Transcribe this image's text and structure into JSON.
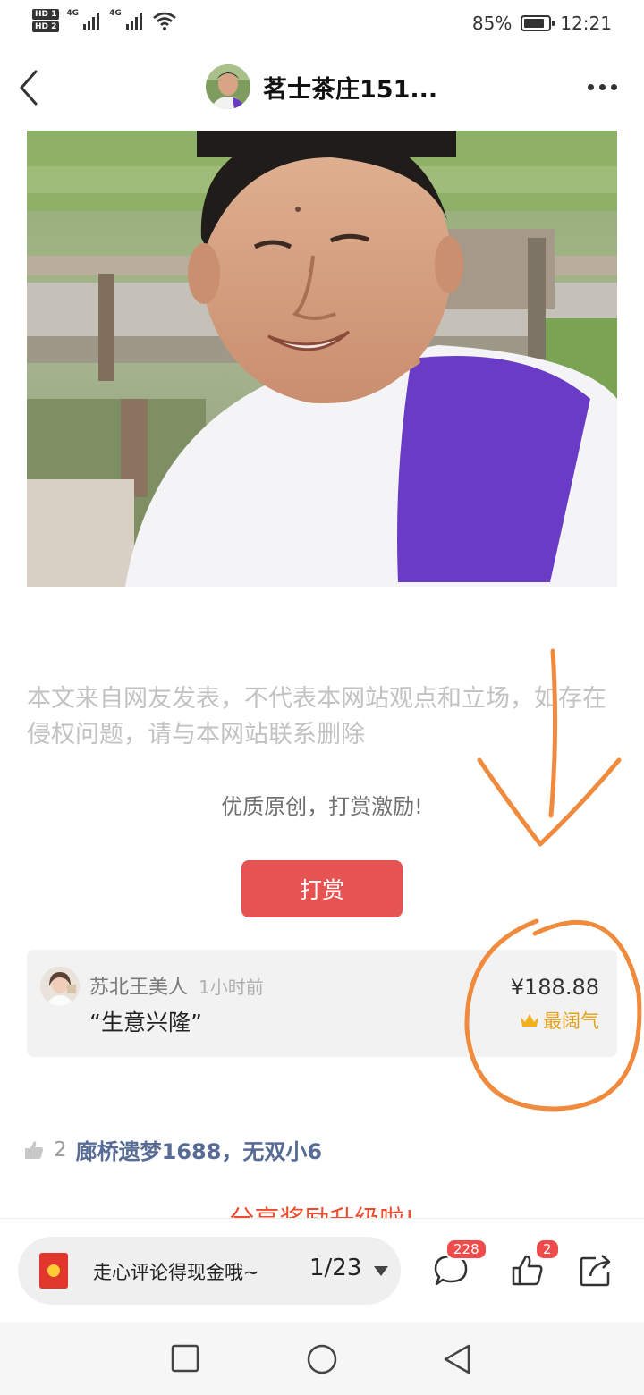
{
  "status_bar": {
    "hd1": "HD 1",
    "hd2": "HD 2",
    "sig1": "4G",
    "sig2": "4G",
    "battery": "85%",
    "battery_level": 0.85,
    "time": "12:21"
  },
  "nav": {
    "title": "茗士茶庄151..."
  },
  "article": {
    "disclaimer": "本文来自网友发表，不代表本网站观点和立场，如存在侵权问题，请与本网站联系删除",
    "reward_caption": "优质原创，打赏激励!",
    "reward_button": "打赏"
  },
  "tip": {
    "name": "苏北王美人",
    "time": "1小时前",
    "message": "“生意兴隆”",
    "amount": "¥188.88",
    "badge": "最阔气"
  },
  "likes": {
    "count": "2",
    "users": "廊桥遗梦1688，无双小6"
  },
  "partial_text": "分享奖励升级啦!",
  "bottom_bar": {
    "pill_text": "走心评论得现金哦~",
    "page": "1/23",
    "comment_count": "228",
    "like_count": "2"
  },
  "colors": {
    "accent_red": "#e55353",
    "link_blue": "#576b95",
    "gold": "#e4a21c",
    "annotation_orange": "#f08a3c"
  }
}
